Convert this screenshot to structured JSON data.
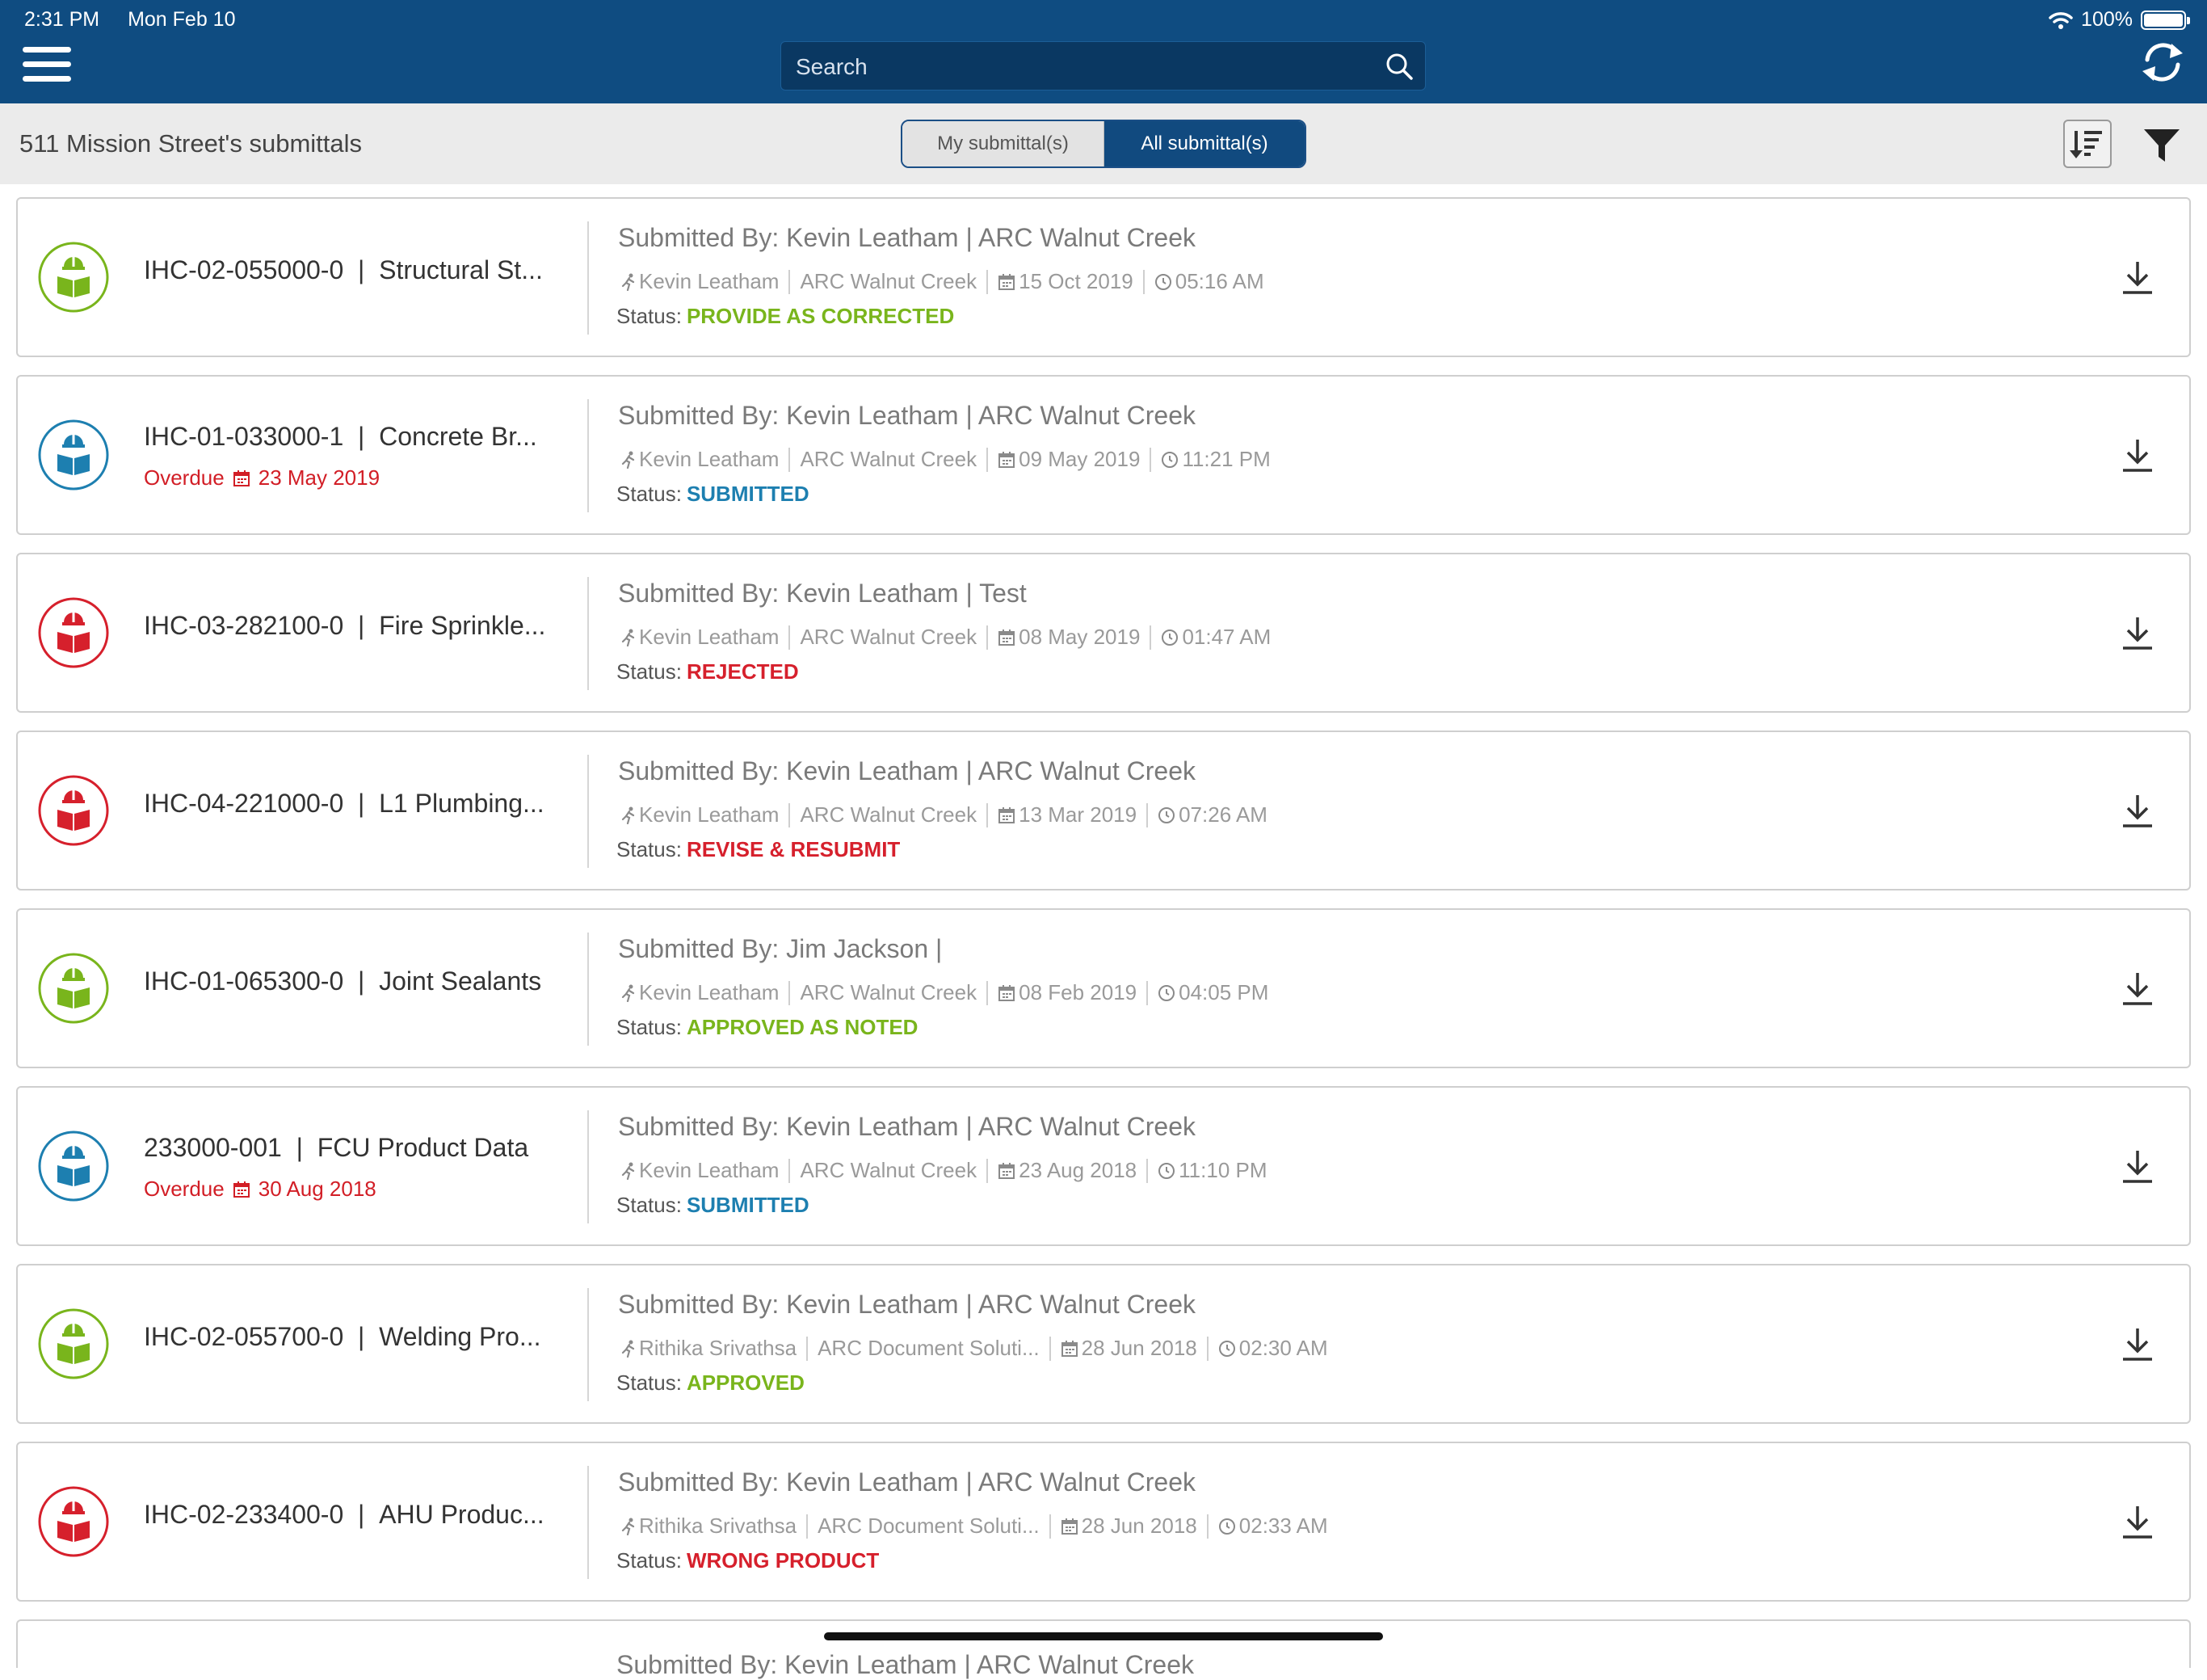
{
  "status_bar": {
    "time": "2:31 PM",
    "date": "Mon Feb 10",
    "battery": "100%"
  },
  "search": {
    "placeholder": "Search"
  },
  "project_title": "511 Mission Street's submittals",
  "segments": {
    "mine": "My submittal(s)",
    "all": "All submittal(s)",
    "selected": "all"
  },
  "labels": {
    "submitted_by": "Submitted By:",
    "status": "Status:",
    "overdue": "Overdue"
  },
  "colors": {
    "green": "#79b51c",
    "blue": "#1d7fb0",
    "red": "#d6202c",
    "header_blue": "#0f4c81"
  },
  "submittals": [
    {
      "id": "IHC-02-055000-0",
      "title": "Structural St...",
      "overdue": false,
      "overdue_date": "",
      "submitted_by": "Kevin Leatham | ARC Walnut Creek",
      "user": "Kevin Leatham",
      "company": "ARC Walnut Creek",
      "date": "15 Oct 2019",
      "time": "05:16 AM",
      "status": "PROVIDE AS CORRECTED",
      "color": "#79b51c",
      "icon": "green"
    },
    {
      "id": "IHC-01-033000-1",
      "title": "Concrete Br...",
      "overdue": true,
      "overdue_date": "23 May 2019",
      "submitted_by": "Kevin Leatham | ARC Walnut Creek",
      "user": "Kevin Leatham",
      "company": "ARC Walnut Creek",
      "date": "09 May 2019",
      "time": "11:21 PM",
      "status": "SUBMITTED",
      "color": "#1d7fb0",
      "icon": "blue"
    },
    {
      "id": "IHC-03-282100-0",
      "title": "Fire Sprinkle...",
      "overdue": false,
      "overdue_date": "",
      "submitted_by": "Kevin Leatham | Test",
      "user": "Kevin Leatham",
      "company": "ARC Walnut Creek",
      "date": "08 May 2019",
      "time": "01:47 AM",
      "status": "REJECTED",
      "color": "#d6202c",
      "icon": "red"
    },
    {
      "id": "IHC-04-221000-0",
      "title": "L1 Plumbing...",
      "overdue": false,
      "overdue_date": "",
      "submitted_by": "Kevin Leatham | ARC Walnut Creek",
      "user": "Kevin Leatham",
      "company": "ARC Walnut Creek",
      "date": "13 Mar 2019",
      "time": "07:26 AM",
      "status": "REVISE & RESUBMIT",
      "color": "#d6202c",
      "icon": "red"
    },
    {
      "id": "IHC-01-065300-0",
      "title": "Joint Sealants",
      "overdue": false,
      "overdue_date": "",
      "submitted_by": "Jim Jackson |",
      "user": "Kevin Leatham",
      "company": "ARC Walnut Creek",
      "date": "08 Feb 2019",
      "time": "04:05 PM",
      "status": "APPROVED AS NOTED",
      "color": "#79b51c",
      "icon": "green"
    },
    {
      "id": "233000-001",
      "title": "FCU Product Data",
      "overdue": true,
      "overdue_date": "30 Aug 2018",
      "submitted_by": "Kevin Leatham | ARC Walnut Creek",
      "user": "Kevin Leatham",
      "company": "ARC Walnut Creek",
      "date": "23 Aug 2018",
      "time": "11:10 PM",
      "status": "SUBMITTED",
      "color": "#1d7fb0",
      "icon": "blue"
    },
    {
      "id": "IHC-02-055700-0",
      "title": "Welding Pro...",
      "overdue": false,
      "overdue_date": "",
      "submitted_by": "Kevin Leatham | ARC Walnut Creek",
      "user": "Rithika Srivathsa",
      "company": "ARC Document Soluti...",
      "date": "28 Jun 2018",
      "time": "02:30 AM",
      "status": "APPROVED",
      "color": "#79b51c",
      "icon": "green"
    },
    {
      "id": "IHC-02-233400-0",
      "title": "AHU Produc...",
      "overdue": false,
      "overdue_date": "",
      "submitted_by": "Kevin Leatham | ARC Walnut Creek",
      "user": "Rithika Srivathsa",
      "company": "ARC Document Soluti...",
      "date": "28 Jun 2018",
      "time": "02:33 AM",
      "status": "WRONG PRODUCT",
      "color": "#d6202c",
      "icon": "red"
    }
  ],
  "partial_row": {
    "submitted_by": "Submitted By: Kevin Leatham | ARC Walnut Creek"
  }
}
